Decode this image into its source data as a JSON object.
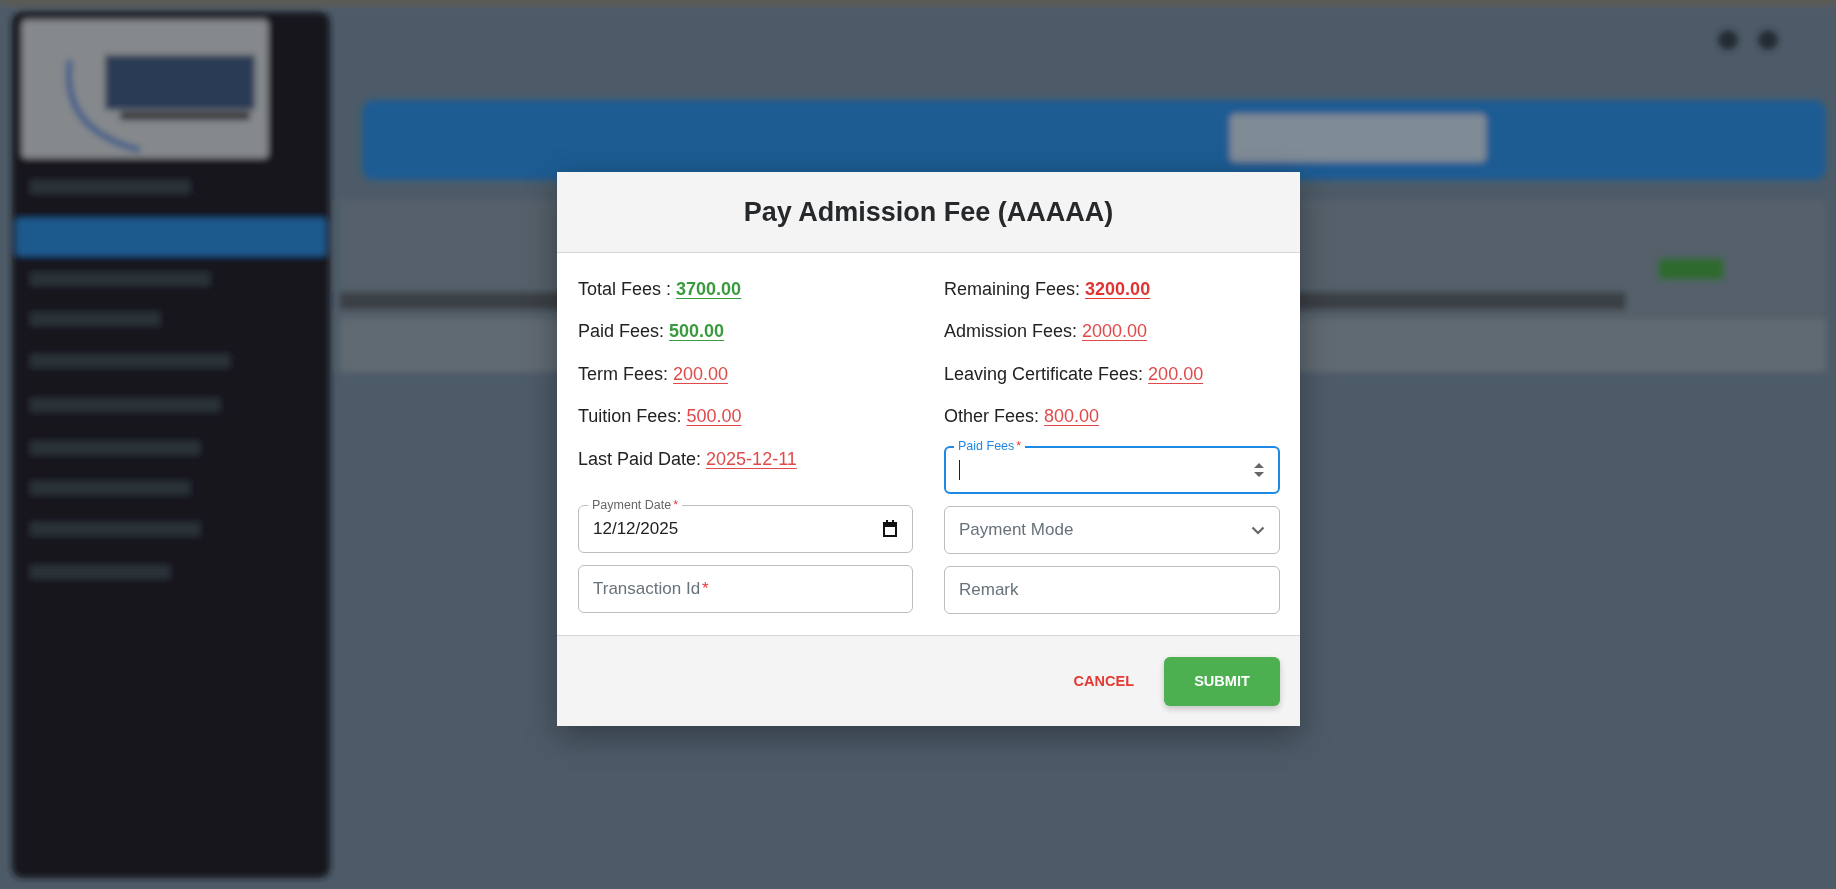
{
  "dialog": {
    "title": "Pay Admission Fee (AAAAA)",
    "columns": [
      {
        "summary": [
          {
            "label": "Total Fees : ",
            "value": "3700.00",
            "color": "#3a9b3e",
            "emphasis": true
          },
          {
            "label": "Paid Fees: ",
            "value": "500.00",
            "color": "#3a9b3e",
            "emphasis": true
          },
          {
            "label": "Term Fees: ",
            "value": "200.00",
            "color": "#e04a4a",
            "emphasis": false
          },
          {
            "label": "Tuition Fees: ",
            "value": "500.00",
            "color": "#e04a4a",
            "emphasis": false
          },
          {
            "label": "Last Paid Date: ",
            "value": "2025-12-11",
            "color": "#e04a4a",
            "emphasis": false
          }
        ],
        "fields": [
          {
            "kind": "date",
            "label": "Payment Date",
            "required_mark": "*",
            "value": "12/12/2025",
            "focused": false
          },
          {
            "kind": "text",
            "label": "Transaction Id",
            "required_mark": "*",
            "focused": false
          }
        ]
      },
      {
        "summary": [
          {
            "label": "Remaining Fees: ",
            "value": "3200.00",
            "color": "#e03434",
            "emphasis": true
          },
          {
            "label": "Admission Fees: ",
            "value": "2000.00",
            "color": "#e04a4a",
            "emphasis": false
          },
          {
            "label": "Leaving Certificate Fees: ",
            "value": "200.00",
            "color": "#e04a4a",
            "emphasis": false
          },
          {
            "label": "Other Fees: ",
            "value": "800.00",
            "color": "#e04a4a",
            "emphasis": false
          }
        ],
        "fields": [
          {
            "kind": "number",
            "label": "Paid Fees",
            "required_mark": "*",
            "focused": true
          },
          {
            "kind": "select",
            "label": "Payment Mode",
            "focused": false
          },
          {
            "kind": "text",
            "label": "Remark",
            "focused": false
          }
        ]
      }
    ],
    "actions": [
      {
        "label": "CANCEL",
        "kind": "text"
      },
      {
        "label": "SUBMIT",
        "kind": "contained"
      }
    ]
  }
}
